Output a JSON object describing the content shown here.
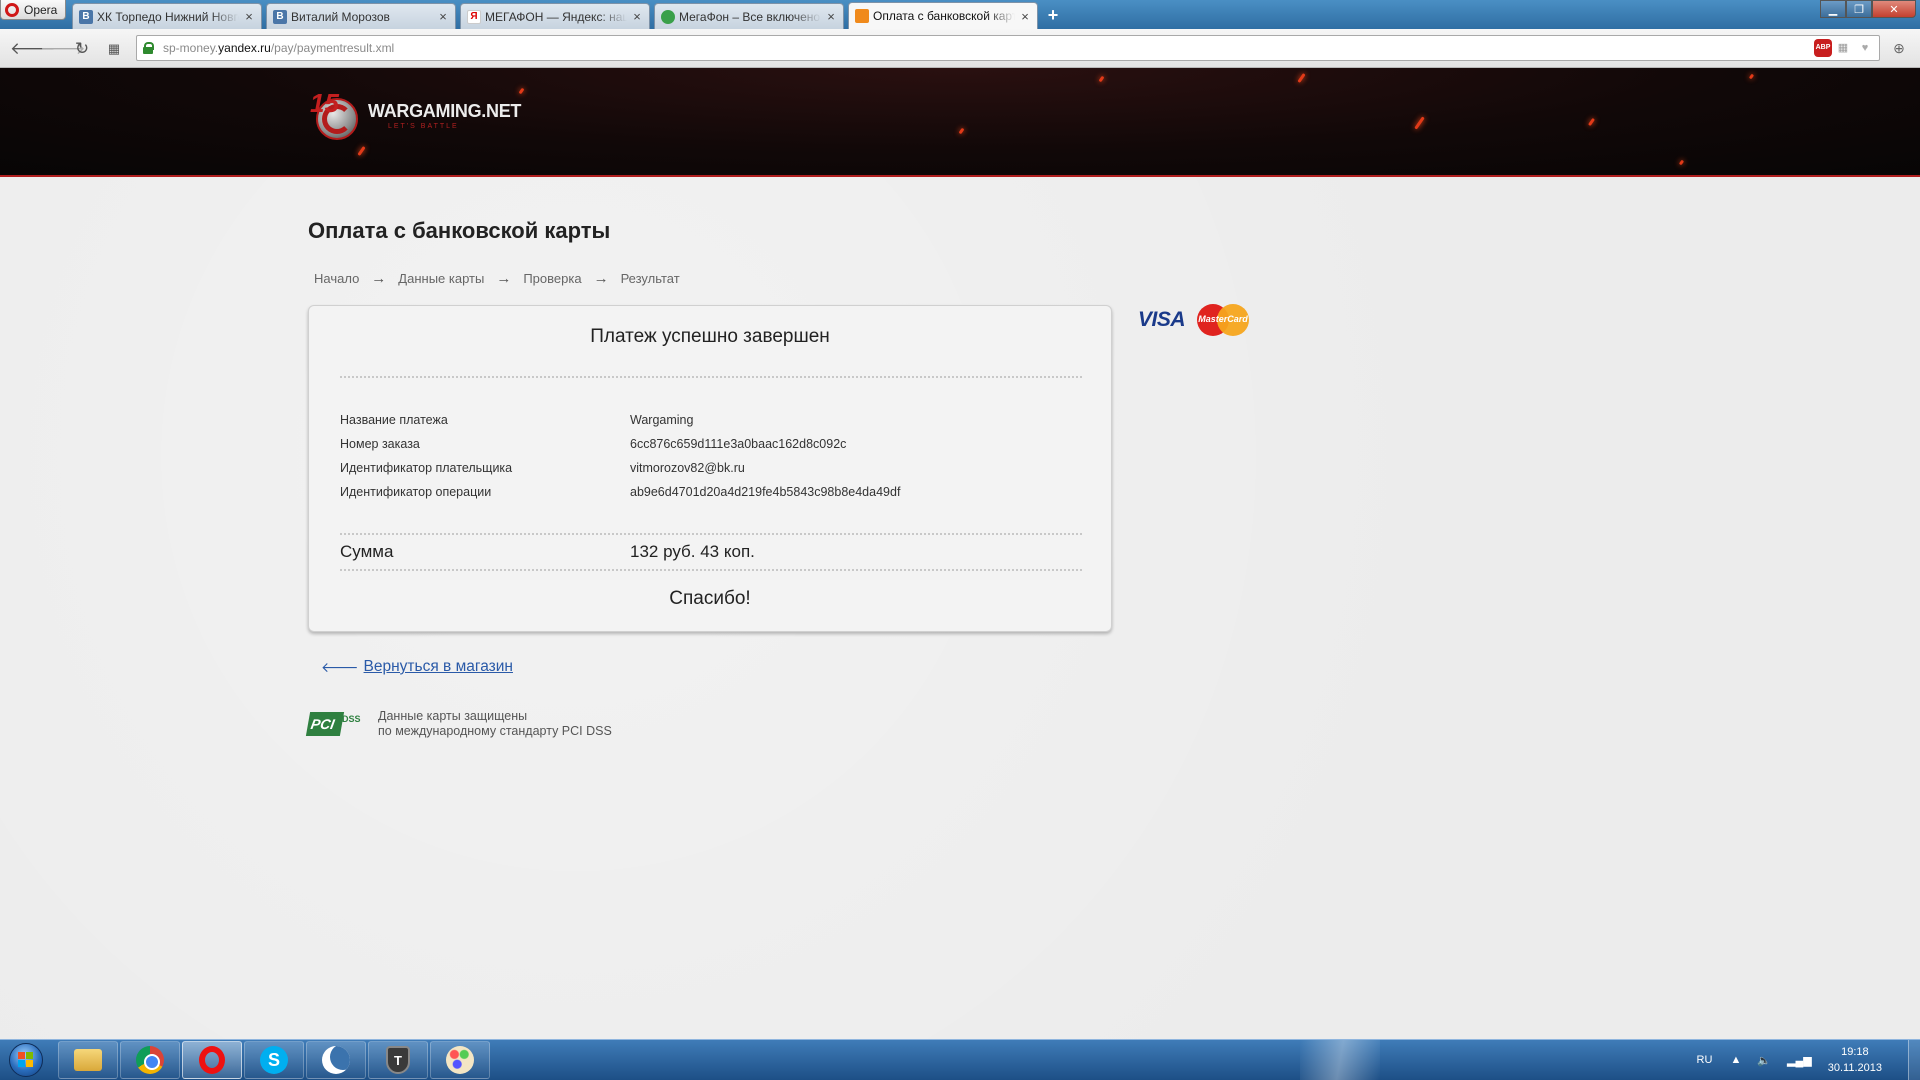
{
  "browser": {
    "app_name": "Opera",
    "tabs": [
      {
        "label": "ХК Торпедо Нижний Новгород",
        "icon": "vk-icon",
        "favicon_text": "В"
      },
      {
        "label": "Виталий Морозов",
        "icon": "vk-icon",
        "favicon_text": "В"
      },
      {
        "label": "МЕГАФОН — Яндекс: нашлось",
        "icon": "yandex-icon",
        "favicon_text": "Я"
      },
      {
        "label": "МегаФон – Все включено",
        "icon": "megafon-icon",
        "favicon_text": ""
      },
      {
        "label": "Оплата с банковской карты",
        "icon": "payment-icon",
        "favicon_text": ""
      }
    ],
    "active_tab": 4,
    "close_glyph": "×",
    "new_tab_glyph": "+",
    "url": {
      "prefix": "sp-money.",
      "host": "yandex.ru",
      "path": "/pay/paymentresult.xml"
    },
    "abp_label": "ABP"
  },
  "header": {
    "logo_name": "WARGAMING.NET",
    "logo_tagline": "LET'S BATTLE",
    "logo_badge": "15"
  },
  "page": {
    "title": "Оплата с банковской карты",
    "steps": [
      "Начало",
      "Данные карты",
      "Проверка",
      "Результат"
    ],
    "step_arrow": "→",
    "card": {
      "heading": "Платеж успешно завершен",
      "rows": [
        {
          "label": "Название платежа",
          "value": "Wargaming"
        },
        {
          "label": "Номер заказа",
          "value": "6cc876c659d111e3a0baac162d8c092c"
        },
        {
          "label": "Идентификатор плательщика",
          "value": "vitmorozov82@bk.ru"
        },
        {
          "label": "Идентификатор операции",
          "value": "ab9e6d4701d20a4d219fe4b5843c98b8e4da49df"
        }
      ],
      "sum_label": "Сумма",
      "sum_value": "132 руб. 43 коп.",
      "thanks": "Спасибо!"
    },
    "payment_logos": {
      "visa": "VISA",
      "mastercard": "MasterCard"
    },
    "back_link": "Вернуться в магазин",
    "back_arrow": "🡐",
    "pci": {
      "logo_letters": "PCI",
      "logo_suffix": "DSS",
      "line1": "Данные карты защищены",
      "line2": "по международному стандарту PCI DSS"
    }
  },
  "taskbar": {
    "apps": [
      "explorer-icon",
      "chrome-icon",
      "opera-icon",
      "skype-icon",
      "moon-icon",
      "world-of-tanks-icon",
      "paint-icon"
    ],
    "skype_letter": "S",
    "wot_letter": "T",
    "language": "RU",
    "time": "19:18",
    "date": "30.11.2013"
  }
}
